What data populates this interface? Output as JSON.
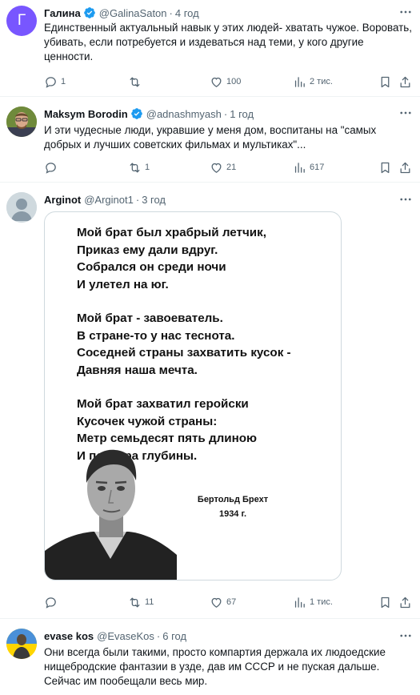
{
  "tweets": [
    {
      "avatar_letter": "Г",
      "avatar_color": "#7856ff",
      "name": "Галина",
      "handle": "@GalinaSaton",
      "time": "4 год",
      "text": "Единственный актуальный навык у этих людей- хватать чужое. Воровать, убивать, если потребуется и издеваться над теми, у кого другие ценности.",
      "replies": "1",
      "retweets": "",
      "likes": "100",
      "views": "2 тис."
    },
    {
      "name": "Maksym Borodin",
      "handle": "@adnashmyash",
      "time": "1 год",
      "text": "И эти чудесные люди, укравшие у меня дом, воспитаны на \"самых добрых и лучших советских фильмах и мультиках\"...",
      "replies": "",
      "retweets": "1",
      "likes": "21",
      "views": "617"
    },
    {
      "name": "Arginot",
      "handle": "@Arginot1",
      "time": "3 год",
      "image": {
        "stanzas": [
          [
            "Мой брат был храбрый летчик,",
            "Приказ ему дали вдруг.",
            "Собрался он среди ночи",
            "И улетел на юг."
          ],
          [
            "Мой брат - завоеватель.",
            "В стране-то у нас теснота.",
            "Соседней страны захватить кусок -",
            "Давняя наша мечта."
          ],
          [
            "Мой брат захватил геройски",
            "Кусочек чужой страны:",
            "Метр семьдесят пять длиною",
            "И полтора глубины."
          ]
        ],
        "signature_name": "Бертольд Брехт",
        "signature_year": "1934 г."
      },
      "replies": "",
      "retweets": "11",
      "likes": "67",
      "views": "1 тис."
    },
    {
      "name": "evase kos",
      "handle": "@EvaseKos",
      "time": "6 год",
      "text": "Они всегда были такими, просто компартия держала их людоедские нищебродские фантазии в узде, дав им СССР и не пуская дальше. Сейчас им пообещали весь мир."
    }
  ],
  "colors": {
    "verified": "#1d9bf0",
    "secondary": "#536471",
    "divider": "#eff3f4"
  },
  "icons": [
    "verified-badge-icon",
    "more-icon",
    "reply-icon",
    "retweet-icon",
    "like-icon",
    "views-icon",
    "bookmark-icon",
    "share-icon"
  ]
}
